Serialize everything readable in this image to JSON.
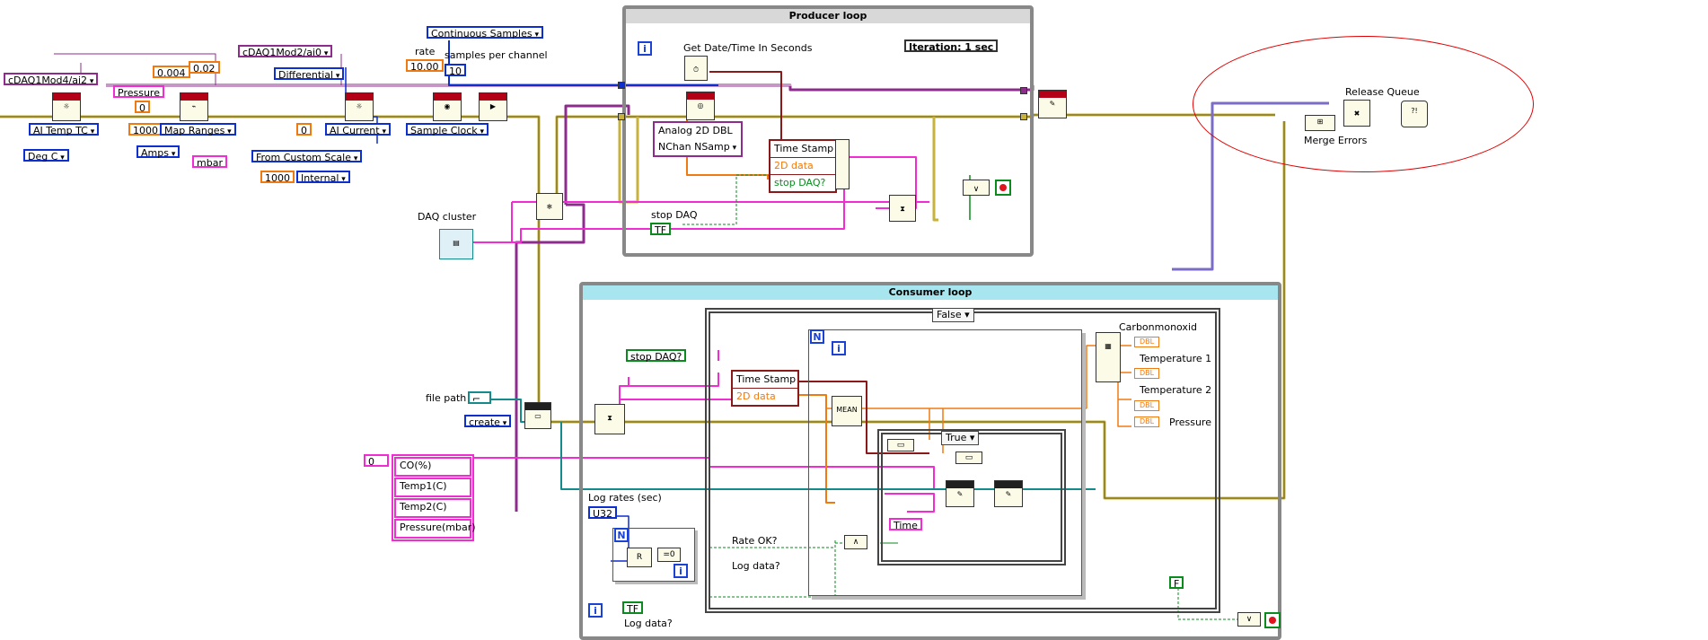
{
  "producer": {
    "title": "Producer loop",
    "get_datetime_label": "Get Date/Time In Seconds",
    "iteration_label": "Iteration: 1 sec",
    "analog_label": "Analog 2D DBL",
    "nchan_label": "NChan NSamp",
    "cluster_items": [
      "Time Stamp",
      "2D data",
      "stop DAQ?"
    ],
    "stop_label": "stop DAQ",
    "tf": "TF"
  },
  "consumer": {
    "title": "Consumer loop",
    "case_false": "False",
    "case_true": "True",
    "stop_daq": "stop DAQ?",
    "cluster_items": [
      "Time Stamp",
      "2D data"
    ],
    "mean": "MEAN",
    "time_const": "Time",
    "rate_ok": "Rate OK?",
    "log_data_inner": "Log data?",
    "log_data_outer": "Log data?",
    "log_rates": "Log rates (sec)",
    "u32": "U32",
    "tf": "TF",
    "f_const": "F",
    "outputs": [
      "Carbonmonoxid",
      "Temperature 1",
      "Temperature 2",
      "Pressure"
    ],
    "dbl": "DBL"
  },
  "left": {
    "chan1": "cDAQ1Mod4/ai2",
    "pressure": "Pressure",
    "v0004": "0.004",
    "v002": "0.02",
    "zero1": "0",
    "chan2": "cDAQ1Mod2/ai0",
    "differential": "Differential",
    "ai_temp": "AI Temp TC",
    "degc": "Deg C",
    "v1000a": "1000",
    "map_ranges": "Map Ranges",
    "amps": "Amps",
    "mbar": "mbar",
    "zero2": "0",
    "ai_current": "AI Current",
    "from_custom": "From Custom Scale",
    "v1000b": "1000",
    "internal": "Internal",
    "cont_samples": "Continuous Samples",
    "rate_label": "rate",
    "rate_val": "10.00",
    "spc_label": "samples per channel",
    "spc_val": "10",
    "sample_clock": "Sample Clock",
    "daq_cluster": "DAQ cluster",
    "file_path": "file path",
    "create": "create",
    "array_index": "0",
    "array_items": [
      "CO(%)",
      "Temp1(C)",
      "Temp2(C)",
      "Pressure(mbar)"
    ]
  },
  "errors": {
    "release_queue": "Release Queue",
    "merge_errors": "Merge Errors"
  },
  "icons": {
    "daqmx": "DAQmx",
    "tdms": "TDMS"
  }
}
